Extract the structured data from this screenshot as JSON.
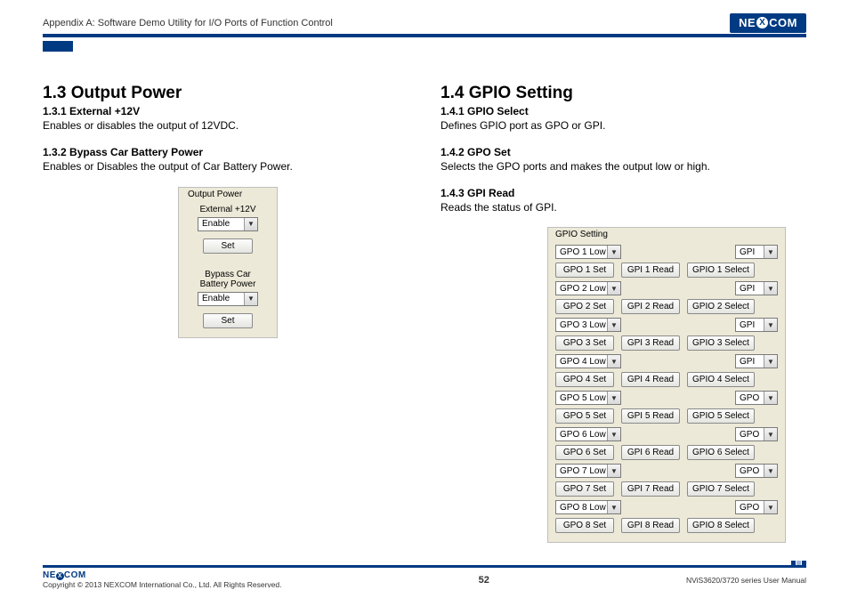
{
  "header": {
    "appendix": "Appendix A: Software Demo Utility for I/O Ports of Function Control",
    "logo_pre": "NE",
    "logo_x": "X",
    "logo_post": "COM"
  },
  "left": {
    "h2": "1.3  Output Power",
    "s1_h": "1.3.1  External +12V",
    "s1_p": "Enables or disables the output of 12VDC.",
    "s2_h": "1.3.2  Bypass Car Battery Power",
    "s2_p": "Enables or Disables the output of Car Battery Power.",
    "panel": {
      "title": "Output Power",
      "ext_label": "External +12V",
      "ext_value": "Enable",
      "set_btn": "Set",
      "bypass_label1": "Bypass Car",
      "bypass_label2": "Battery Power",
      "bypass_value": "Enable"
    }
  },
  "right": {
    "h2": "1.4  GPIO Setting",
    "s1_h": "1.4.1  GPIO Select",
    "s1_p": "Defines GPIO port as GPO or GPI.",
    "s2_h": "1.4.2  GPO Set",
    "s2_p": "Selects the GPO ports and makes the output low or high.",
    "s3_h": "1.4.3  GPI Read",
    "s3_p": "Reads the status of GPI.",
    "panel": {
      "title": "GPIO Setting",
      "rows": [
        {
          "gpo": "GPO 1 Low",
          "set": "GPO 1 Set",
          "read": "GPI 1 Read",
          "sel": "GPIO 1 Select",
          "mode": "GPI"
        },
        {
          "gpo": "GPO 2 Low",
          "set": "GPO 2 Set",
          "read": "GPI 2 Read",
          "sel": "GPIO 2 Select",
          "mode": "GPI"
        },
        {
          "gpo": "GPO 3 Low",
          "set": "GPO 3 Set",
          "read": "GPI 3 Read",
          "sel": "GPIO 3 Select",
          "mode": "GPI"
        },
        {
          "gpo": "GPO 4 Low",
          "set": "GPO 4 Set",
          "read": "GPI 4 Read",
          "sel": "GPIO 4 Select",
          "mode": "GPI"
        },
        {
          "gpo": "GPO 5 Low",
          "set": "GPO 5 Set",
          "read": "GPI 5 Read",
          "sel": "GPIO 5 Select",
          "mode": "GPO"
        },
        {
          "gpo": "GPO 6 Low",
          "set": "GPO 6 Set",
          "read": "GPI 6 Read",
          "sel": "GPIO 6 Select",
          "mode": "GPO"
        },
        {
          "gpo": "GPO 7 Low",
          "set": "GPO 7 Set",
          "read": "GPI 7 Read",
          "sel": "GPIO 7 Select",
          "mode": "GPO"
        },
        {
          "gpo": "GPO 8 Low",
          "set": "GPO 8 Set",
          "read": "GPI 8 Read",
          "sel": "GPIO 8 Select",
          "mode": "GPO"
        }
      ]
    }
  },
  "footer": {
    "logo": "NE  COM",
    "copyright": "Copyright © 2013 NEXCOM International Co., Ltd. All Rights Reserved.",
    "page": "52",
    "manual": "NViS3620/3720 series User Manual"
  },
  "glyph": {
    "down": "▼"
  }
}
